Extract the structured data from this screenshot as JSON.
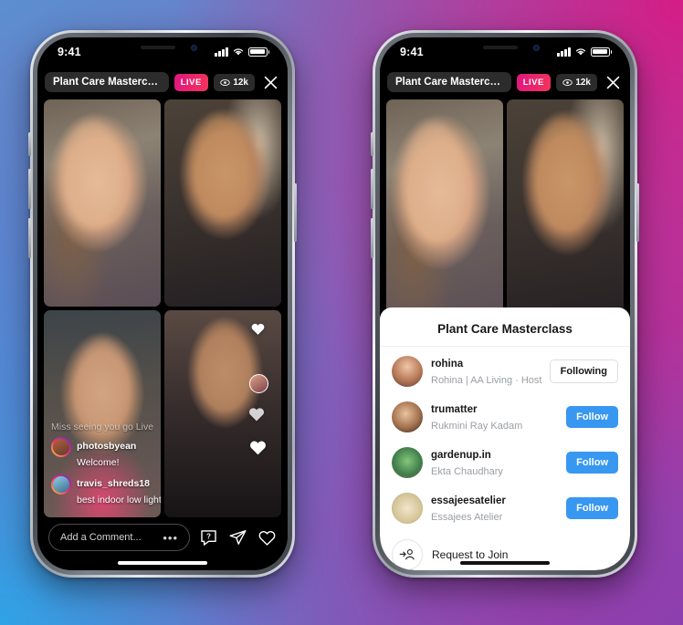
{
  "background": {
    "gradient_colors": [
      "#5b8fd0",
      "#2fa3e6",
      "#d41d86",
      "#8e3faf"
    ]
  },
  "phones": [
    {
      "name": "phone-live-grid",
      "status_bar": {
        "time": "9:41",
        "signal_icon": "cellular-bars-icon",
        "wifi_icon": "wifi-icon",
        "battery_icon": "battery-icon"
      },
      "live_header": {
        "title": "Plant Care Mastercla...",
        "live_label": "LIVE",
        "viewers": "12k",
        "eye_icon": "eye-icon",
        "close_icon": "close-x-icon"
      },
      "comments": {
        "faded_notice": "Miss seeing you go Live!",
        "items": [
          {
            "username": "photosbyean",
            "text": "Welcome!"
          },
          {
            "username": "travis_shreds18",
            "text": "best indoor low light plan to maintain?"
          }
        ]
      },
      "bottom_bar": {
        "comment_placeholder": "Add a Comment...",
        "more_icon": "ellipsis-icon",
        "question_icon": "question-bubble-icon",
        "share_icon": "paper-plane-icon",
        "like_icon": "heart-icon"
      }
    },
    {
      "name": "phone-participant-sheet",
      "status_bar": {
        "time": "9:41",
        "signal_icon": "cellular-bars-icon",
        "wifi_icon": "wifi-icon",
        "battery_icon": "battery-icon"
      },
      "live_header": {
        "title": "Plant Care Mastercla...",
        "live_label": "LIVE",
        "viewers": "12k",
        "eye_icon": "eye-icon",
        "close_icon": "close-x-icon"
      },
      "sheet": {
        "grab_handle": "drag-handle",
        "title": "Plant Care Masterclass",
        "users": [
          {
            "username": "rohina",
            "subtitle": "Rohina | AA Living · Host",
            "action": "Following",
            "action_state": "following"
          },
          {
            "username": "trumatter",
            "subtitle": "Rukmini Ray Kadam",
            "action": "Follow",
            "action_state": "follow"
          },
          {
            "username": "gardenup.in",
            "subtitle": "Ekta Chaudhary",
            "action": "Follow",
            "action_state": "follow"
          },
          {
            "username": "essajeesatelier",
            "subtitle": "Essajees Atelier",
            "action": "Follow",
            "action_state": "follow"
          }
        ],
        "request_row": {
          "icon": "add-person-icon",
          "label": "Request to Join"
        }
      }
    }
  ],
  "colors": {
    "follow_blue": "#3897f0",
    "live_pink": "#e0167f",
    "live_red": "#f2355b"
  }
}
